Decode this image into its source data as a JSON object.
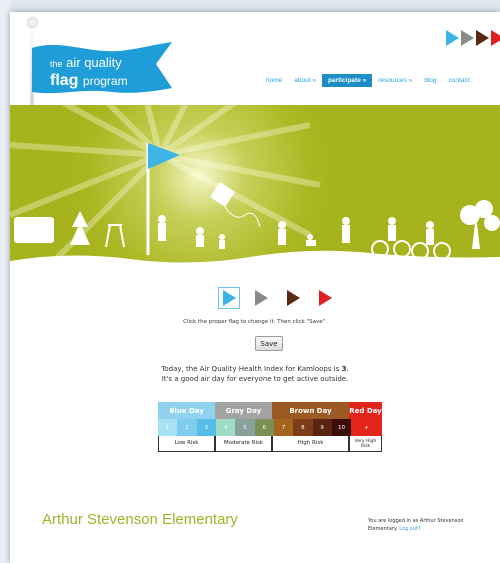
{
  "logo": {
    "line1_small": "the",
    "line1": "air quality",
    "line2": "flag",
    "line2_thin": "program"
  },
  "nav": {
    "items": [
      {
        "label": "home",
        "active": false
      },
      {
        "label": "about »",
        "active": false
      },
      {
        "label": "participate »",
        "active": true
      },
      {
        "label": "resources »",
        "active": false
      },
      {
        "label": "blog",
        "active": false
      },
      {
        "label": "contact",
        "active": false
      }
    ]
  },
  "flag_colors": {
    "blue": "#3cb4e5",
    "gray": "#8a8a8a",
    "brown": "#5a2a10",
    "red": "#e02020"
  },
  "instructions": "Click the proper flag to change it. Then click \"Save\".",
  "save_label": "Save",
  "today": {
    "prefix": "Today, the Air Quality Health Index for Kamloops is ",
    "value": "3",
    "suffix": ".",
    "line2": "It's a good air day for everyone to get active outside."
  },
  "aqhi": {
    "days": [
      {
        "label": "Blue Day",
        "color": "#8fd2ef"
      },
      {
        "label": "Gray Day",
        "color": "#a3a3a3"
      },
      {
        "label": "Brown Day",
        "color": "#9a5a22"
      },
      {
        "label": "Red Day",
        "color": "#e3241b"
      }
    ],
    "numbers": [
      {
        "n": "1",
        "color": "#a9e0f5"
      },
      {
        "n": "2",
        "color": "#7fcdee"
      },
      {
        "n": "3",
        "color": "#55bde7"
      },
      {
        "n": "4",
        "color": "#9fdcc4"
      },
      {
        "n": "5",
        "color": "#8aa09a"
      },
      {
        "n": "6",
        "color": "#7a8f52"
      },
      {
        "n": "7",
        "color": "#a4641e"
      },
      {
        "n": "8",
        "color": "#7d3b18"
      },
      {
        "n": "9",
        "color": "#5a2410"
      },
      {
        "n": "10",
        "color": "#3c0b0b"
      },
      {
        "n": "+",
        "color": "#e3241b"
      }
    ],
    "risks": [
      "Low Risk",
      "Moderate Risk",
      "High Risk",
      "Very High Risk"
    ]
  },
  "school_name": "Arthur Stevenson Elementary",
  "login": {
    "text": "You are logged in as Arthur Stevenson Elementary.",
    "link": "Log out?"
  }
}
